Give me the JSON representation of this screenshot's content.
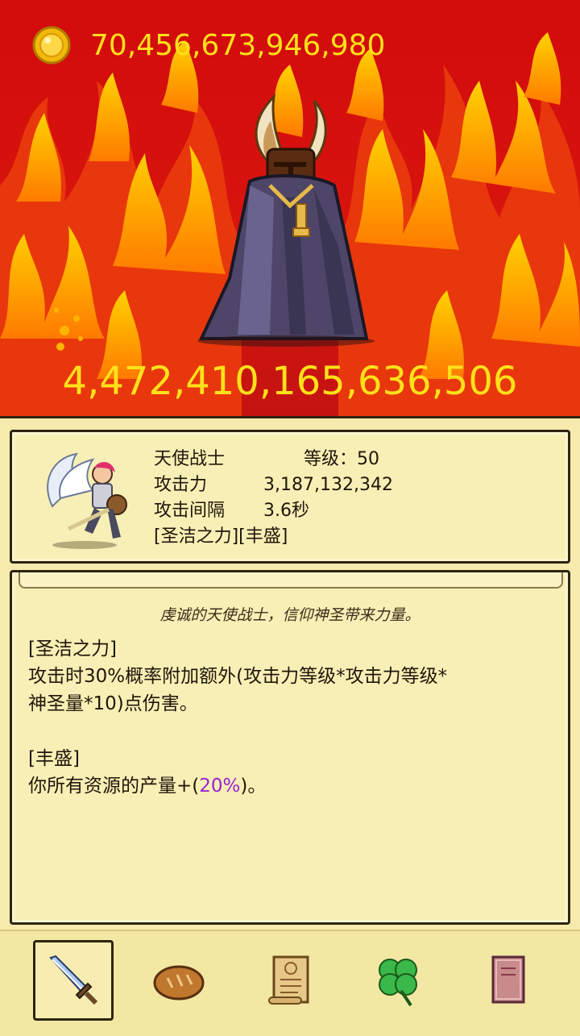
{
  "gold": {
    "amount": "70,456,673,946,980",
    "icon": "gold-coin-icon"
  },
  "boss": {
    "hp": "4,472,410,165,636,506",
    "icon": "horned-cloaked-demon-icon"
  },
  "hero": {
    "name": "天使战士",
    "level_label": "等级：50",
    "attack_label": "攻击力",
    "attack_value": "3,187,132,342",
    "interval_label": "攻击间隔",
    "interval_value": "3.6秒",
    "traits": "[圣洁之力][丰盛]"
  },
  "description": {
    "flavor": "虔诚的天使战士，信仰神圣带来力量。",
    "skill1_title": "[圣洁之力]",
    "skill1_line1": "攻击时30%概率附加额外(攻击力等级*攻击力等级*",
    "skill1_line2": "神圣量*10)点伤害。",
    "skill2_title": "[丰盛]",
    "skill2_prefix": "你所有资源的产量+(",
    "skill2_pct": "20%",
    "skill2_suffix": ")。"
  },
  "tabs": [
    {
      "icon": "sword-icon",
      "active": true
    },
    {
      "icon": "bread-icon",
      "active": false
    },
    {
      "icon": "scroll-icon",
      "active": false
    },
    {
      "icon": "clover-icon",
      "active": false
    },
    {
      "icon": "book-icon",
      "active": false
    }
  ],
  "colors": {
    "gold_text": "#ffe11a",
    "panel": "#f6ebad",
    "highlight": "#9a22d0"
  }
}
